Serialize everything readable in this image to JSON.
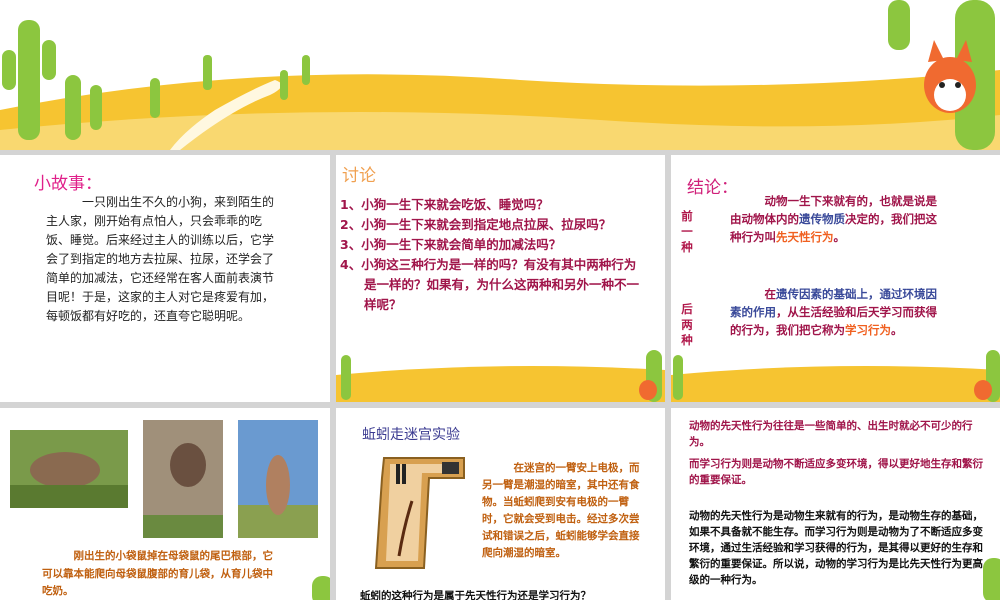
{
  "story": {
    "title": "小故事：",
    "body": "一只刚出生不久的小狗，来到陌生的主人家，刚开始有点怕人，只会乖乖的吃饭、睡觉。后来经过主人的训练以后，它学会了到指定的地方去拉屎、拉尿，还学会了简单的加减法，它还经常在客人面前表演节目呢！于是，这家的主人对它是疼爱有加，每顿饭都有好吃的，还直夸它聪明呢。"
  },
  "discussion": {
    "title": "讨论",
    "items": [
      "1、小狗一生下来就会吃饭、睡觉吗？",
      "2、小狗一生下来就会到指定地点拉屎、拉尿吗？",
      "3、小狗一生下来就会简单的加减法吗？",
      "4、小狗这三种行为是一样的吗？有没有其中两种行为是一样的？如果有，为什么这两种和另外一种不一样呢？"
    ]
  },
  "conclusion": {
    "title": "结论：",
    "first_label": "前一种",
    "first_a": "动物一生下来就有的，也就是说是由动物体内的",
    "first_b": "遗传物质",
    "first_c": "决定的，我们把这种行为叫",
    "first_d": "先天性行为",
    "first_e": "。",
    "second_label": "后两种",
    "second_a": "在",
    "second_b": "遗传因素的基础上，通过环境因素的作用",
    "second_c": "，从生活经验和后天学习而获得的行为，我们把它称为",
    "second_d": "学习行为",
    "second_e": "。"
  },
  "kangaroo": {
    "text": "刚出生的小袋鼠掉在母袋鼠的尾巴根部，它可以靠本能爬向母袋鼠腹部的育儿袋，从育儿袋中吃奶。"
  },
  "maze": {
    "title": "蚯蚓走迷宫实验",
    "text": "在迷宫的一臂安上电极，而另一臂是潮湿的暗室，其中还有食物。当蚯蚓爬到安有电极的一臂时，它就会受到电击。经过多次尝试和错误之后，蚯蚓能够学会直接爬向潮湿的暗室。",
    "question": "蚯蚓的这种行为是属于先天性行为还是学习行为？"
  },
  "summary": {
    "p1": "动物的先天性行为往往是一些简单的、出生时就必不可少的行为。",
    "p2": "而学习行为则是动物不断适应多变环境，得以更好地生存和繁衍的重要保证。",
    "p3": "动物的先天性行为是动物生来就有的行为，是动物生存的基础，如果不具备就不能生存。而学习行为则是动物为了不断适应多变环境，通过生活经验和学习获得的行为，是其得以更好的生存和繁衍的重要保证。所以说，动物的学习行为是比先天性行为更高级的一种行为。"
  }
}
